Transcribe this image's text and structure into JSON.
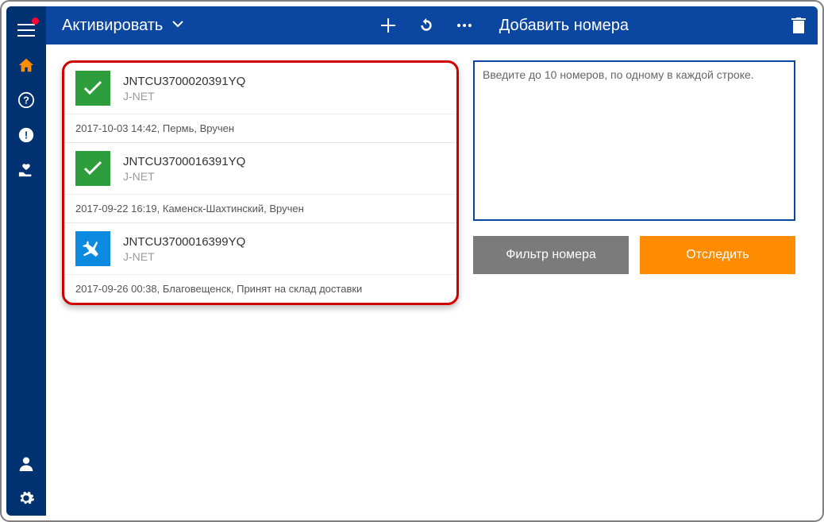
{
  "topbar": {
    "activate_label": "Активировать",
    "add_numbers_label": "Добавить номера"
  },
  "tracking": [
    {
      "status": "delivered",
      "number": "JNTCU3700020391YQ",
      "carrier": "J-NET",
      "detail": "2017-10-03 14:42, Пермь, Вручен"
    },
    {
      "status": "delivered",
      "number": "JNTCU3700016391YQ",
      "carrier": "J-NET",
      "detail": "2017-09-22 16:19, Каменск-Шахтинский, Вручен"
    },
    {
      "status": "transit",
      "number": "JNTCU3700016399YQ",
      "carrier": "J-NET",
      "detail": "2017-09-26 00:38, Благовещенск, Принят на склад доставки"
    }
  ],
  "right": {
    "placeholder": "Введите до 10 номеров, по одному в каждой строке.",
    "filter_btn": "Фильтр номера",
    "track_btn": "Отследить"
  }
}
